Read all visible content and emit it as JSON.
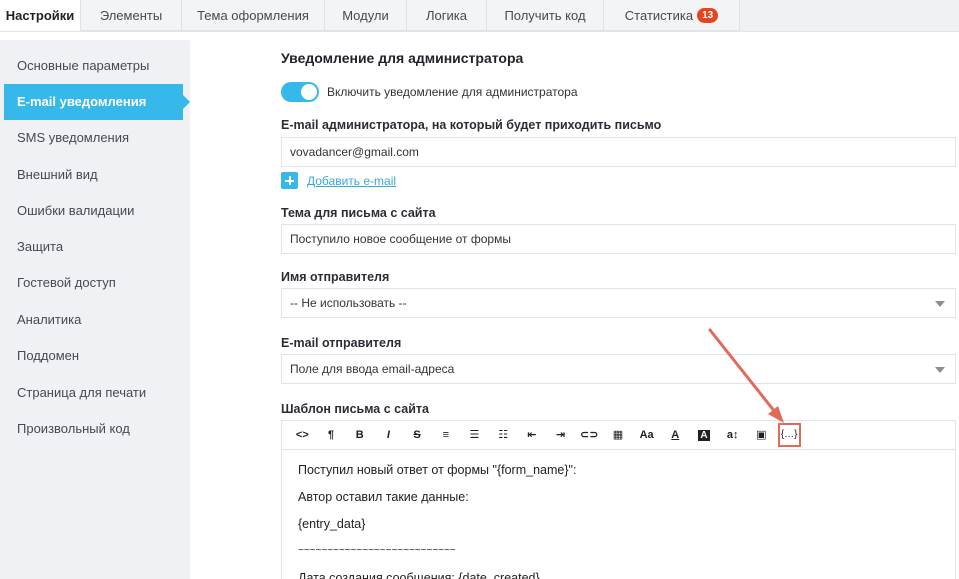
{
  "tabs": [
    {
      "label": "Настройки",
      "active": true
    },
    {
      "label": "Элементы"
    },
    {
      "label": "Тема оформления"
    },
    {
      "label": "Модули"
    },
    {
      "label": "Логика"
    },
    {
      "label": "Получить код"
    },
    {
      "label": "Статистика",
      "badge": "13"
    }
  ],
  "sidebar": {
    "items": [
      {
        "label": "Основные параметры"
      },
      {
        "label": "E-mail уведомления",
        "active": true
      },
      {
        "label": "SMS уведомления"
      },
      {
        "label": "Внешний вид"
      },
      {
        "label": "Ошибки валидации"
      },
      {
        "label": "Защита"
      },
      {
        "label": "Гостевой доступ"
      },
      {
        "label": "Аналитика"
      },
      {
        "label": "Поддомен"
      },
      {
        "label": "Страница для печати"
      },
      {
        "label": "Произвольный код"
      }
    ]
  },
  "main": {
    "section_title": "Уведомление для администратора",
    "toggle_label": "Включить уведомление для администратора",
    "toggle_on": true,
    "admin_email_label": "E-mail администратора, на который будет приходить письмо",
    "admin_email_value": "vovadancer@gmail.com",
    "add_email_label": "Добавить e-mail",
    "subject_label": "Тема для письма с сайта",
    "subject_value": "Поступило новое сообщение от формы",
    "sender_name_label": "Имя отправителя",
    "sender_name_value": "-- Не использовать --",
    "sender_email_label": "E-mail отправителя",
    "sender_email_value": "Поле для ввода email-адреса",
    "template_label": "Шаблон письма с сайта"
  },
  "editor": {
    "toolbar": [
      {
        "icon": "code-view-icon",
        "glyph": "<>"
      },
      {
        "icon": "paragraph-icon",
        "glyph": "¶"
      },
      {
        "icon": "bold-icon",
        "glyph": "B"
      },
      {
        "icon": "italic-icon",
        "glyph": "I"
      },
      {
        "icon": "strikethrough-icon",
        "glyph": "S"
      },
      {
        "icon": "align-left-icon",
        "glyph": "≡"
      },
      {
        "icon": "bullet-list-icon",
        "glyph": "☰"
      },
      {
        "icon": "numbered-list-icon",
        "glyph": "☷"
      },
      {
        "icon": "outdent-icon",
        "glyph": "⇤"
      },
      {
        "icon": "indent-icon",
        "glyph": "⇥"
      },
      {
        "icon": "link-icon",
        "glyph": "⊂⊃"
      },
      {
        "icon": "table-icon",
        "glyph": "▦"
      },
      {
        "icon": "font-size-icon",
        "glyph": "Aa"
      },
      {
        "icon": "text-color-icon",
        "glyph": "A"
      },
      {
        "icon": "background-color-icon",
        "glyph": "A"
      },
      {
        "icon": "line-height-icon",
        "glyph": "a↕"
      },
      {
        "icon": "image-icon",
        "glyph": "▣"
      },
      {
        "icon": "variables-icon",
        "glyph": "{…}",
        "highlighted": true
      }
    ],
    "lines": [
      "Поступил новый ответ от формы \"{form_name}\":",
      "Автор оставил такие данные:",
      "{entry_data}",
      "~~~~~~~~~~~~~~~~~~~~~~~~~~~",
      "Дата создания сообщения: {date_created}"
    ]
  },
  "colors": {
    "accent": "#36b8ea",
    "badge": "#e8431e",
    "highlight": "#e26a5a",
    "sidebar_bg": "#f0f1f4"
  }
}
